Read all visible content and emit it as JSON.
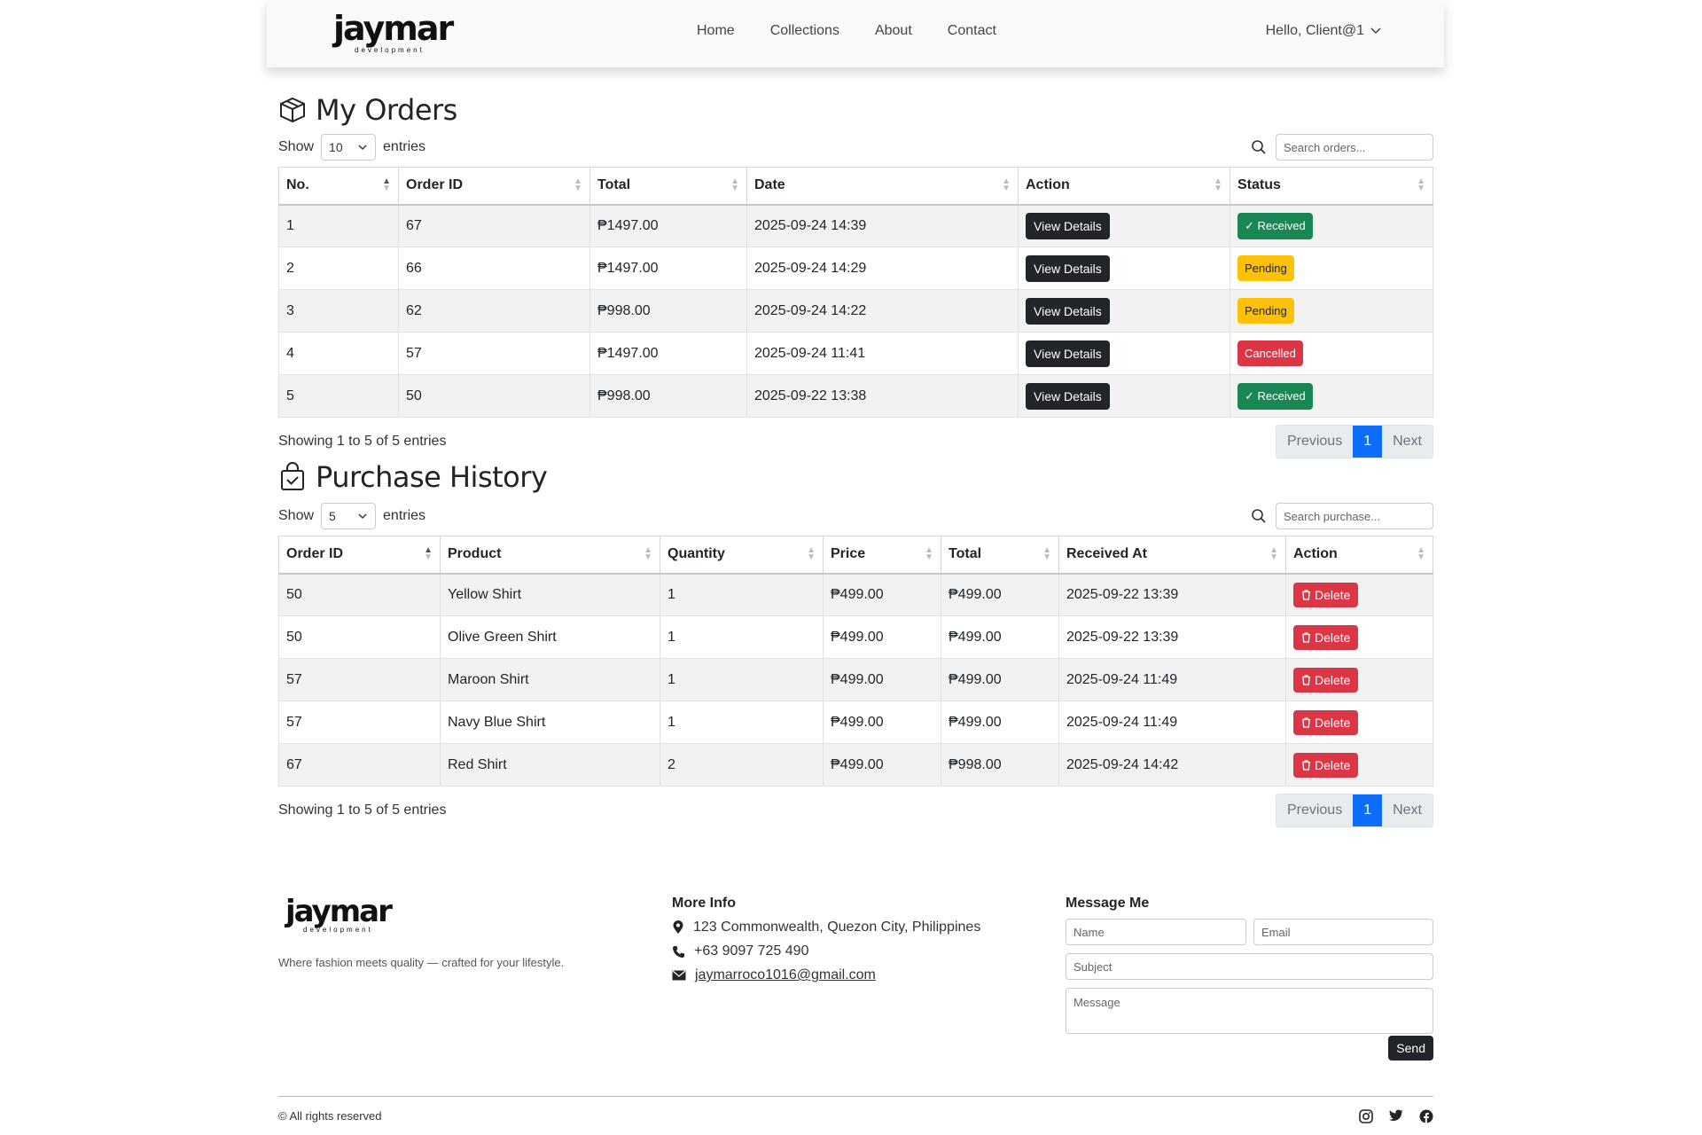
{
  "nav": {
    "brand_word": "jaymar",
    "brand_sub": "development",
    "links": [
      "Home",
      "Collections",
      "About",
      "Contact"
    ],
    "user_greeting": "Hello, Client@1"
  },
  "orders": {
    "title": "My Orders",
    "show_label": "Show",
    "entries_label": "entries",
    "page_size": "10",
    "search_placeholder": "Search orders...",
    "columns": [
      "No.",
      "Order ID",
      "Total",
      "Date",
      "Action",
      "Status"
    ],
    "rows": [
      {
        "no": "1",
        "order_id": "67",
        "total": "₱1497.00",
        "date": "2025-09-24 14:39",
        "action": "View Details",
        "status": "Received",
        "status_type": "success"
      },
      {
        "no": "2",
        "order_id": "66",
        "total": "₱1497.00",
        "date": "2025-09-24 14:29",
        "action": "View Details",
        "status": "Pending",
        "status_type": "warning"
      },
      {
        "no": "3",
        "order_id": "62",
        "total": "₱998.00",
        "date": "2025-09-24 14:22",
        "action": "View Details",
        "status": "Pending",
        "status_type": "warning"
      },
      {
        "no": "4",
        "order_id": "57",
        "total": "₱1497.00",
        "date": "2025-09-24 11:41",
        "action": "View Details",
        "status": "Cancelled",
        "status_type": "danger"
      },
      {
        "no": "5",
        "order_id": "50",
        "total": "₱998.00",
        "date": "2025-09-22 13:38",
        "action": "View Details",
        "status": "Received",
        "status_type": "success"
      }
    ],
    "info": "Showing 1 to 5 of 5 entries",
    "pager": {
      "prev": "Previous",
      "current": "1",
      "next": "Next"
    }
  },
  "history": {
    "title": "Purchase History",
    "show_label": "Show",
    "entries_label": "entries",
    "page_size": "5",
    "search_placeholder": "Search purchase...",
    "columns": [
      "Order ID",
      "Product",
      "Quantity",
      "Price",
      "Total",
      "Received At",
      "Action"
    ],
    "rows": [
      {
        "order_id": "50",
        "product": "Yellow Shirt",
        "quantity": "1",
        "price": "₱499.00",
        "total": "₱499.00",
        "received_at": "2025-09-22 13:39",
        "action": "Delete"
      },
      {
        "order_id": "50",
        "product": "Olive Green Shirt",
        "quantity": "1",
        "price": "₱499.00",
        "total": "₱499.00",
        "received_at": "2025-09-22 13:39",
        "action": "Delete"
      },
      {
        "order_id": "57",
        "product": "Maroon Shirt",
        "quantity": "1",
        "price": "₱499.00",
        "total": "₱499.00",
        "received_at": "2025-09-24 11:49",
        "action": "Delete"
      },
      {
        "order_id": "57",
        "product": "Navy Blue Shirt",
        "quantity": "1",
        "price": "₱499.00",
        "total": "₱499.00",
        "received_at": "2025-09-24 11:49",
        "action": "Delete"
      },
      {
        "order_id": "67",
        "product": "Red Shirt",
        "quantity": "2",
        "price": "₱499.00",
        "total": "₱998.00",
        "received_at": "2025-09-24 14:42",
        "action": "Delete"
      }
    ],
    "info": "Showing 1 to 5 of 5 entries",
    "pager": {
      "prev": "Previous",
      "current": "1",
      "next": "Next"
    }
  },
  "footer": {
    "tagline": "Where fashion meets quality — crafted for your lifestyle.",
    "more_info_title": "More Info",
    "address": "123 Commonwealth, Quezon City, Philippines",
    "phone": "+63 9097 725 490",
    "email": "jaymarroco1016@gmail.com",
    "message_title": "Message Me",
    "name_placeholder": "Name",
    "email_placeholder": "Email",
    "subject_placeholder": "Subject",
    "message_placeholder": "Message",
    "send_label": "Send",
    "copyright": "© All rights reserved"
  },
  "colors": {
    "success": "#198754",
    "warning": "#ffc107",
    "danger": "#dc3545",
    "dark": "#212529",
    "primary": "#0d6efd"
  }
}
